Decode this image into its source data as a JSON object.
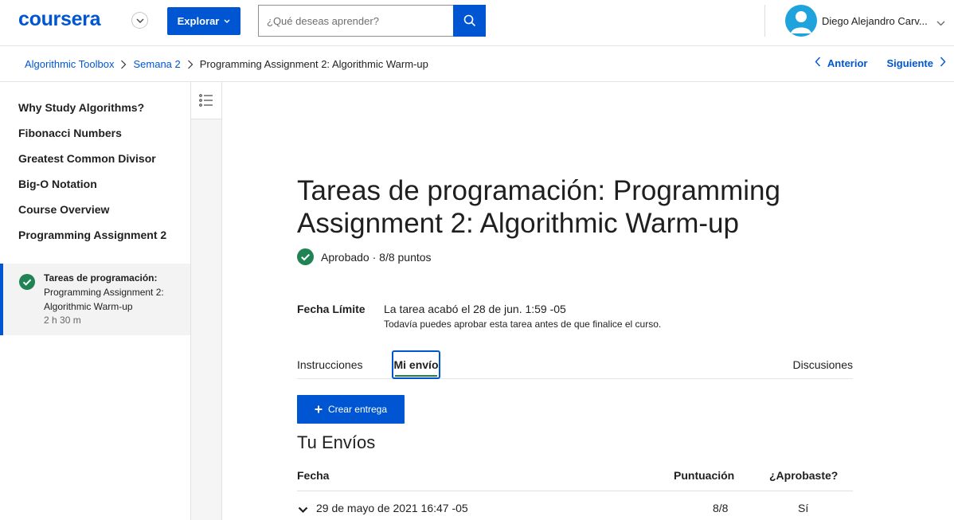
{
  "header": {
    "logo": "coursera",
    "explore_label": "Explorar",
    "search_placeholder": "¿Qué deseas aprender?",
    "user_name": "Diego Alejandro Carv..."
  },
  "breadcrumb": {
    "items": [
      "Algorithmic Toolbox",
      "Semana 2"
    ],
    "current": "Programming Assignment 2: Algorithmic Warm-up",
    "prev_label": "Anterior",
    "next_label": "Siguiente"
  },
  "sidebar": {
    "items": [
      "Why Study Algorithms?",
      "Fibonacci Numbers",
      "Greatest Common Divisor",
      "Big-O Notation",
      "Course Overview",
      "Programming Assignment 2"
    ],
    "active": {
      "type_label": "Tareas de programación:",
      "name": "Programming Assignment 2: Algorithmic Warm-up",
      "duration": "2 h 30 m"
    }
  },
  "main": {
    "title": "Tareas de programación: Programming Assignment 2: Algorithmic Warm-up",
    "status": "Aprobado · 8/8 puntos",
    "due_label": "Fecha Límite",
    "due_value": "La tarea acabó el 28 de jun. 1:59 -05",
    "due_note": "Todavía puedes aprobar esta tarea antes de que finalice el curso.",
    "tabs": {
      "instructions": "Instrucciones",
      "my_submission": "Mi envío",
      "discussions": "Discusiones"
    },
    "create_label": "Crear entrega",
    "submissions_title": "Tu Envíos",
    "table": {
      "headers": {
        "date": "Fecha",
        "score": "Puntuación",
        "passed": "¿Aprobaste?"
      },
      "rows": [
        {
          "date": "29 de mayo de 2021 16:47 -05",
          "score": "8/8",
          "passed": "Sí"
        }
      ]
    }
  },
  "colors": {
    "brand_blue": "#0056d2",
    "success_green": "#1f8354",
    "avatar_blue": "#1fa3dc"
  },
  "icons": {
    "outline": "list-outline-icon",
    "search": "search-icon",
    "check": "check-circle-icon"
  }
}
